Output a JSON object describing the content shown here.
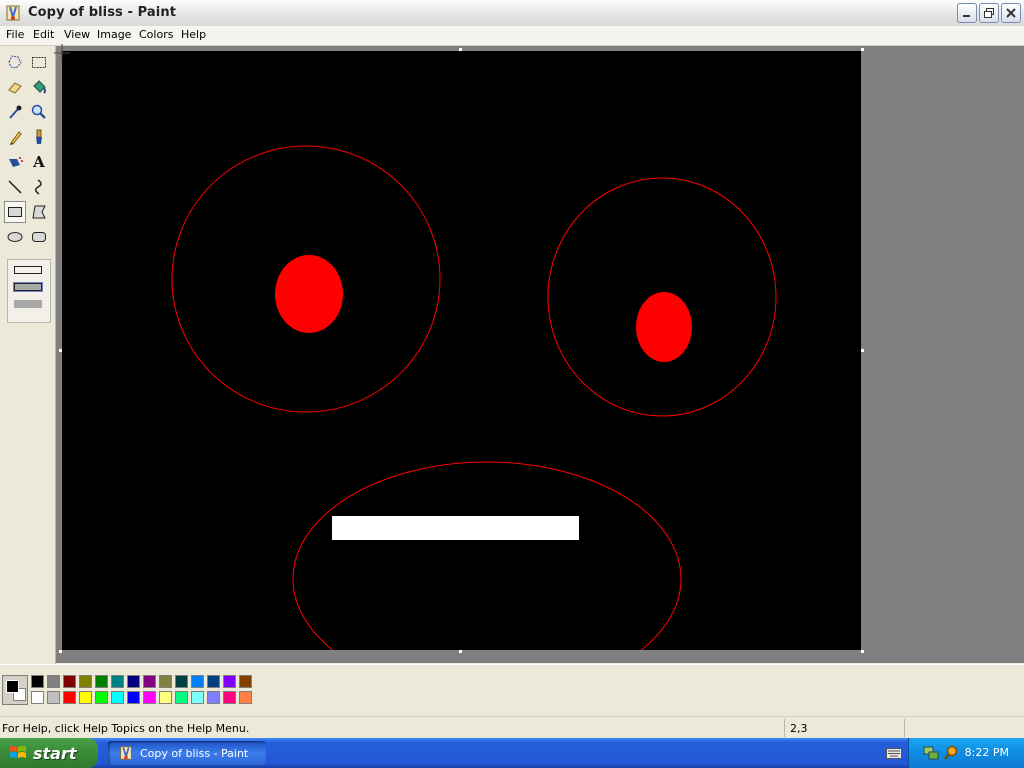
{
  "window": {
    "title": "Copy of bliss - Paint"
  },
  "menu": [
    "File",
    "Edit",
    "View",
    "Image",
    "Colors",
    "Help"
  ],
  "tools": [
    {
      "name": "free-form-select-icon",
      "active": false
    },
    {
      "name": "select-icon",
      "active": false
    },
    {
      "name": "eraser-icon",
      "active": false
    },
    {
      "name": "fill-bucket-icon",
      "active": false
    },
    {
      "name": "pick-color-icon",
      "active": false
    },
    {
      "name": "magnifier-icon",
      "active": false
    },
    {
      "name": "pencil-icon",
      "active": false
    },
    {
      "name": "brush-icon",
      "active": false
    },
    {
      "name": "airbrush-icon",
      "active": false
    },
    {
      "name": "text-icon",
      "active": false
    },
    {
      "name": "line-icon",
      "active": false
    },
    {
      "name": "curve-icon",
      "active": false
    },
    {
      "name": "rectangle-icon",
      "active": true
    },
    {
      "name": "polygon-icon",
      "active": false
    },
    {
      "name": "ellipse-icon",
      "active": false
    },
    {
      "name": "rounded-rectangle-icon",
      "active": false
    }
  ],
  "tool_text_glyph": "A",
  "colors": {
    "foreground": "#000000",
    "background": "#FFFFFF",
    "palette_top": [
      "#000000",
      "#808080",
      "#800000",
      "#808000",
      "#008000",
      "#008080",
      "#000080",
      "#800080",
      "#808040",
      "#004040",
      "#0080FF",
      "#004080",
      "#8000FF",
      "#804000"
    ],
    "palette_bottom": [
      "#FFFFFF",
      "#C0C0C0",
      "#FF0000",
      "#FFFF00",
      "#00FF00",
      "#00FFFF",
      "#0000FF",
      "#FF00FF",
      "#FFFF80",
      "#00FF80",
      "#80FFFF",
      "#8080FF",
      "#FF0080",
      "#FF8040"
    ]
  },
  "drawing": {
    "outline_color": "#FF0000",
    "pupil_color": "#FF0000",
    "tooth_color": "#FFFFFF"
  },
  "status": {
    "help_text": "For Help, click Help Topics on the Help Menu.",
    "coordinates": "2,3"
  },
  "taskbar": {
    "start_label": "start",
    "task_label": "Copy of bliss - Paint",
    "clock": "8:22 PM"
  }
}
